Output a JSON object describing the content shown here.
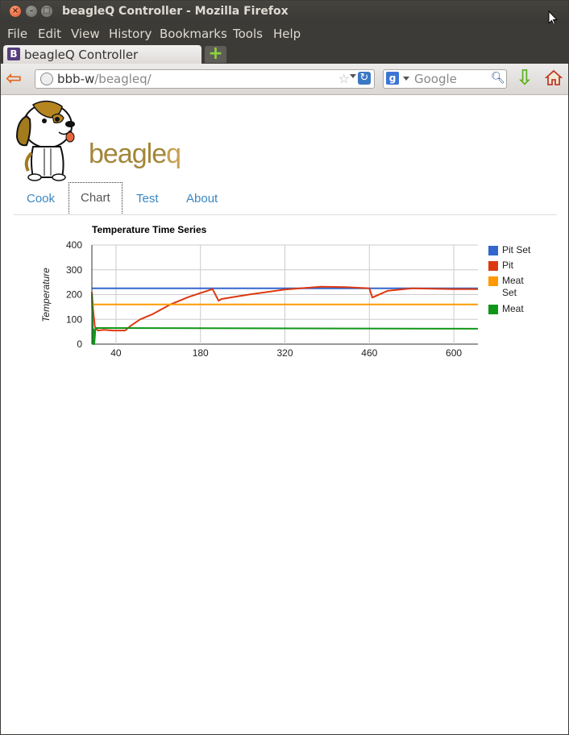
{
  "window": {
    "title": "beagleQ Controller - Mozilla Firefox"
  },
  "menu": [
    "File",
    "Edit",
    "View",
    "History",
    "Bookmarks",
    "Tools",
    "Help"
  ],
  "browser_tab": {
    "label": "beagleQ Controller",
    "favicon": "B"
  },
  "address": {
    "host": "bbb-w",
    "path": "/beagleq/"
  },
  "search": {
    "placeholder": "Google"
  },
  "page": {
    "brand_text": "beagle",
    "brand_q": "q",
    "tabs": [
      "Cook",
      "Chart",
      "Test",
      "About"
    ],
    "active_tab": "Chart"
  },
  "colors": {
    "pit_set": "#3366cc",
    "pit": "#dc3912",
    "meat_set": "#ff9900",
    "meat": "#109618",
    "link": "#3a87c3"
  },
  "chart_data": {
    "type": "line",
    "title": "Temperature Time Series",
    "ylabel": "Temperature",
    "xlabel": "",
    "xlim": [
      0,
      640
    ],
    "ylim": [
      0,
      400
    ],
    "x_ticks": [
      40,
      180,
      320,
      460,
      600
    ],
    "y_ticks": [
      0,
      100,
      200,
      300,
      400
    ],
    "grid": true,
    "legend_position": "right",
    "series": [
      {
        "name": "Pit Set",
        "x": [
          0,
          640
        ],
        "y": [
          225,
          225
        ]
      },
      {
        "name": "Pit",
        "x": [
          0,
          2,
          5,
          10,
          20,
          35,
          55,
          65,
          80,
          100,
          130,
          160,
          200,
          210,
          215,
          260,
          320,
          380,
          420,
          460,
          465,
          490,
          530,
          600,
          640
        ],
        "y": [
          210,
          140,
          70,
          55,
          58,
          55,
          55,
          75,
          100,
          120,
          160,
          190,
          222,
          175,
          182,
          200,
          220,
          232,
          230,
          225,
          188,
          215,
          225,
          222,
          222
        ]
      },
      {
        "name": "Meat Set",
        "x": [
          0,
          640
        ],
        "y": [
          160,
          160
        ]
      },
      {
        "name": "Meat",
        "x": [
          0,
          2,
          3,
          4,
          6,
          640
        ],
        "y": [
          200,
          0,
          60,
          0,
          65,
          62
        ]
      }
    ]
  }
}
